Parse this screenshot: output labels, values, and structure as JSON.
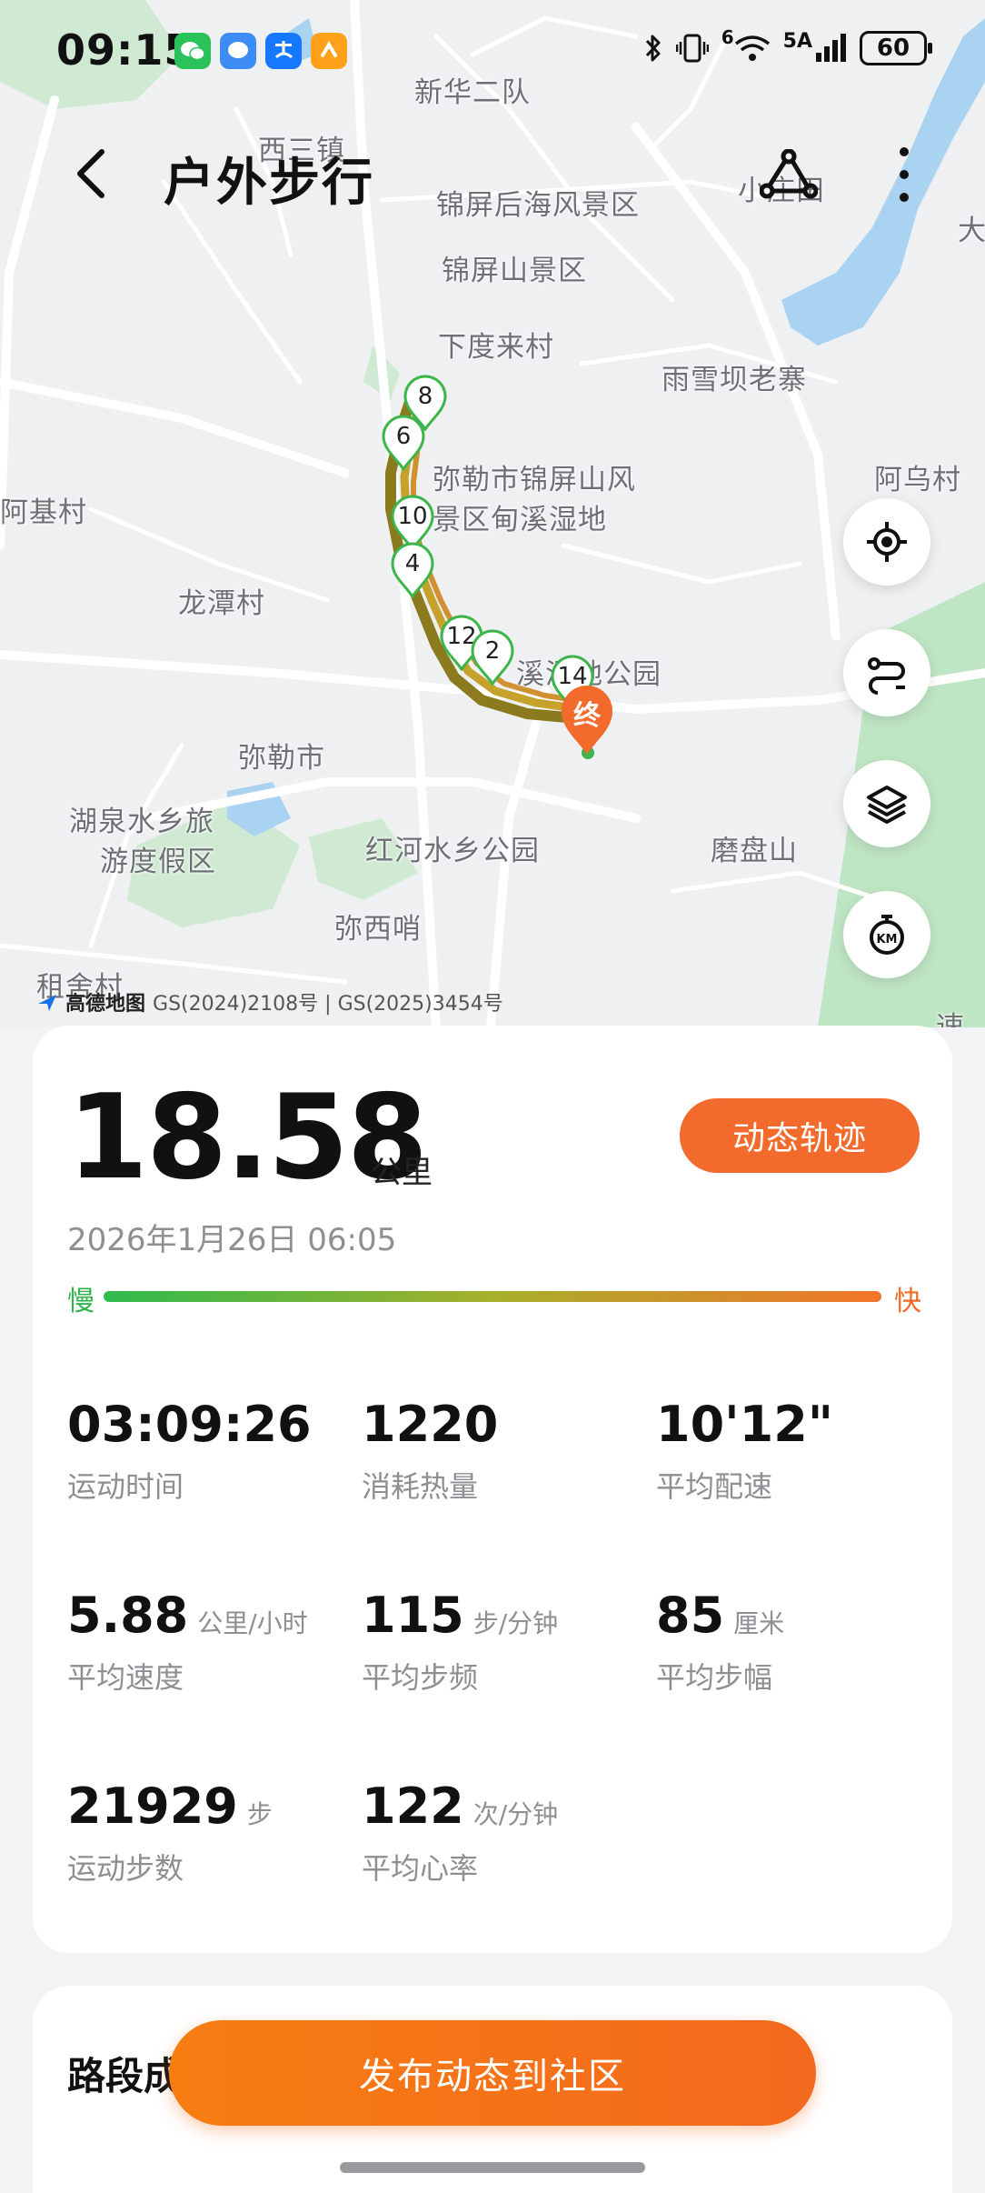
{
  "status_bar": {
    "time": "09:15",
    "network": "5A",
    "signal_sup": "6",
    "battery": "60"
  },
  "header": {
    "title": "户外步行"
  },
  "map": {
    "labels": [
      "新华二队",
      "西三镇",
      "锦屏后海风景区",
      "小庄田",
      "锦屏山景区",
      "下度来村",
      "雨雪坝老寨",
      "弥勒市锦屏山风",
      "景区甸溪湿地",
      "阿乌村",
      "阿基村",
      "龙潭村",
      "溪湿地公园",
      "弥勒市",
      "湖泉水乡旅",
      "游度假区",
      "红河水乡公园",
      "磨盘山",
      "弥西哨",
      "租舍村",
      "大",
      "速"
    ],
    "markers": [
      "8",
      "6",
      "10",
      "4",
      "12",
      "2",
      "14"
    ],
    "end_marker": "终",
    "attribution_logo": "高德地图",
    "attribution": "GS(2024)2108号 | GS(2025)3454号"
  },
  "summary": {
    "distance": "18.58",
    "distance_unit": "公里",
    "replay_button": "动态轨迹",
    "date": "2026年1月26日 06:05",
    "slow_label": "慢",
    "fast_label": "快"
  },
  "stats": [
    {
      "value": "03:09:26",
      "unit": "",
      "label": "运动时间"
    },
    {
      "value": "1220",
      "unit": "",
      "label": "消耗热量"
    },
    {
      "value": "10'12\"",
      "unit": "",
      "label": "平均配速"
    },
    {
      "value": "5.88",
      "unit": "公里/小时",
      "label": "平均速度"
    },
    {
      "value": "115",
      "unit": "步/分钟",
      "label": "平均步频"
    },
    {
      "value": "85",
      "unit": "厘米",
      "label": "平均步幅"
    },
    {
      "value": "21929",
      "unit": "步",
      "label": "运动步数"
    },
    {
      "value": "122",
      "unit": "次/分钟",
      "label": "平均心率"
    }
  ],
  "section": {
    "title": "路段成"
  },
  "publish_button": "发布动态到社区",
  "colors": {
    "accent": "#f26a2c",
    "slow": "#2dbb4c",
    "fast": "#f3752a",
    "marker": "#3cb54a"
  }
}
